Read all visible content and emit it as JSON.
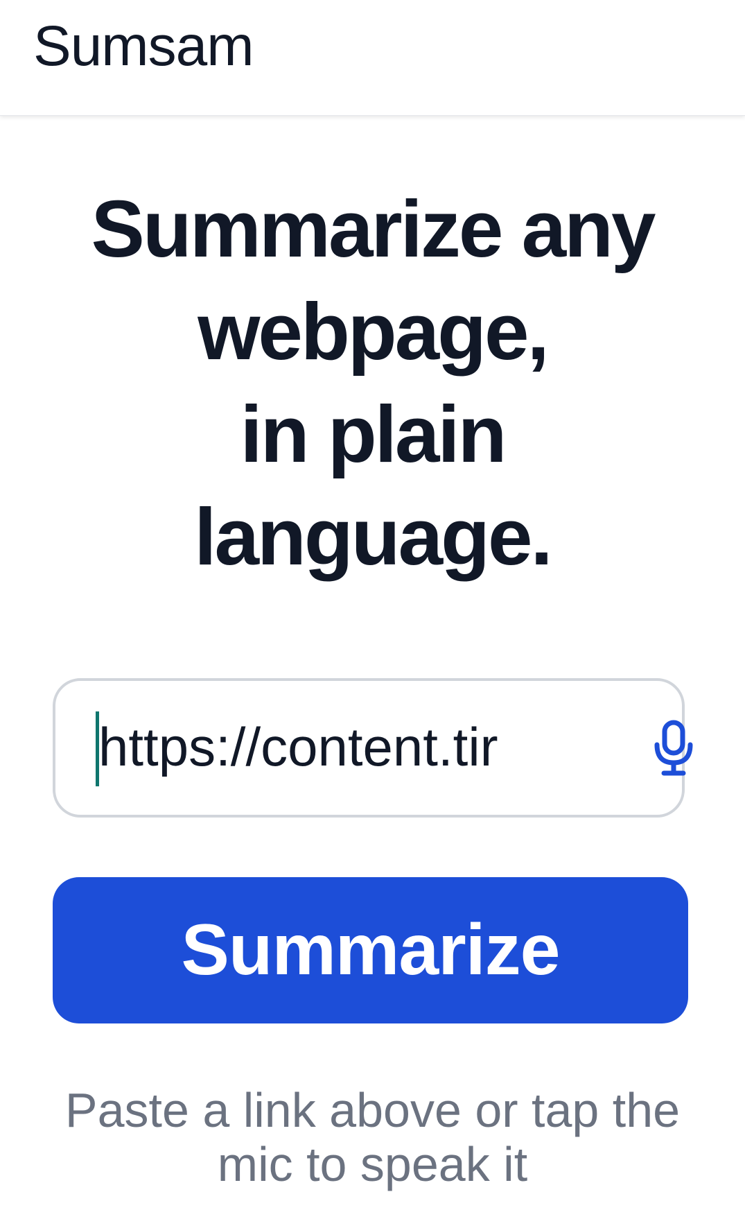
{
  "header": {
    "app_title": "Sumsam"
  },
  "hero": {
    "heading_lines": [
      "Summarize any",
      "webpage,",
      "in plain",
      "language."
    ]
  },
  "url_input": {
    "value": "https://content.tir",
    "mic_icon": "microphone-icon"
  },
  "actions": {
    "summarize_label": "Summarize"
  },
  "helper": {
    "lines": [
      "Paste a link above or tap the",
      "mic to speak it"
    ]
  },
  "colors": {
    "accent": "#1D4ED8",
    "text_primary": "#111827",
    "text_muted": "#6B7280",
    "input_border": "#D1D5DB",
    "caret": "#0F766E"
  }
}
